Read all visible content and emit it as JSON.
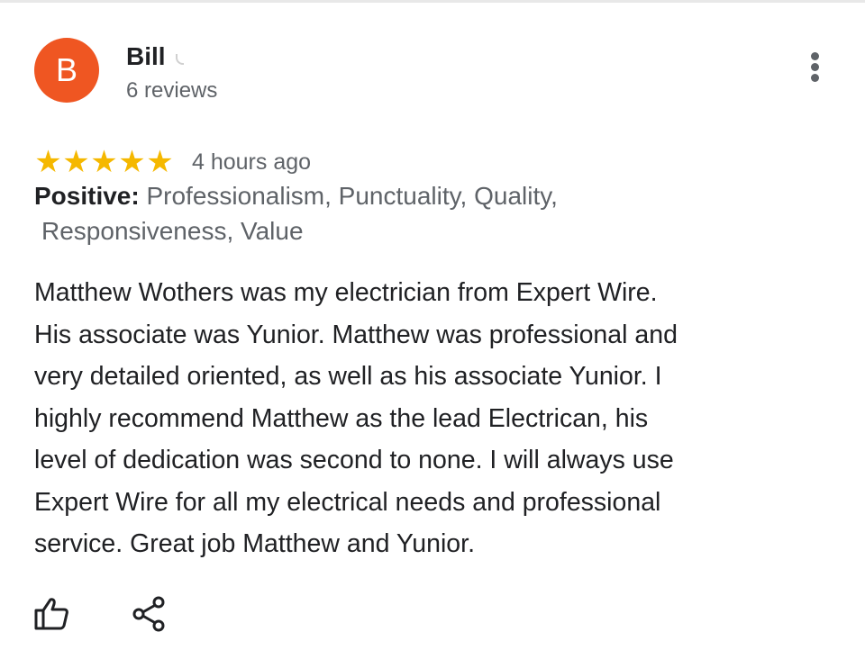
{
  "reviewer": {
    "avatar_initial": "B",
    "name": "Bill",
    "review_count": "6 reviews"
  },
  "rating": {
    "stars": [
      "★",
      "★",
      "★",
      "★",
      "★"
    ],
    "value": 5,
    "time": "4 hours ago"
  },
  "positive": {
    "label": "Positive:",
    "line1": " Professionalism, Punctuality, Quality,",
    "line2": "Responsiveness, Value"
  },
  "review": {
    "lines": [
      "Matthew Wothers was my electrician from Expert Wire.",
      "His associate was Yunior. Matthew was professional and",
      "very detailed oriented, as well as his associate Yunior. I",
      "highly recommend Matthew as the lead Electrican, his",
      "level of dedication was second to none. I will always use",
      "Expert Wire for all my electrical needs and professional",
      "service. Great job Matthew and Yunior."
    ]
  },
  "actions": {
    "like_icon": "thumbs-up-icon",
    "share_icon": "share-icon",
    "more_icon": "more-vert-icon"
  },
  "colors": {
    "avatar": "#ef5622",
    "star": "#f5b800",
    "secondary_text": "#5f6368",
    "primary_text": "#202124"
  }
}
